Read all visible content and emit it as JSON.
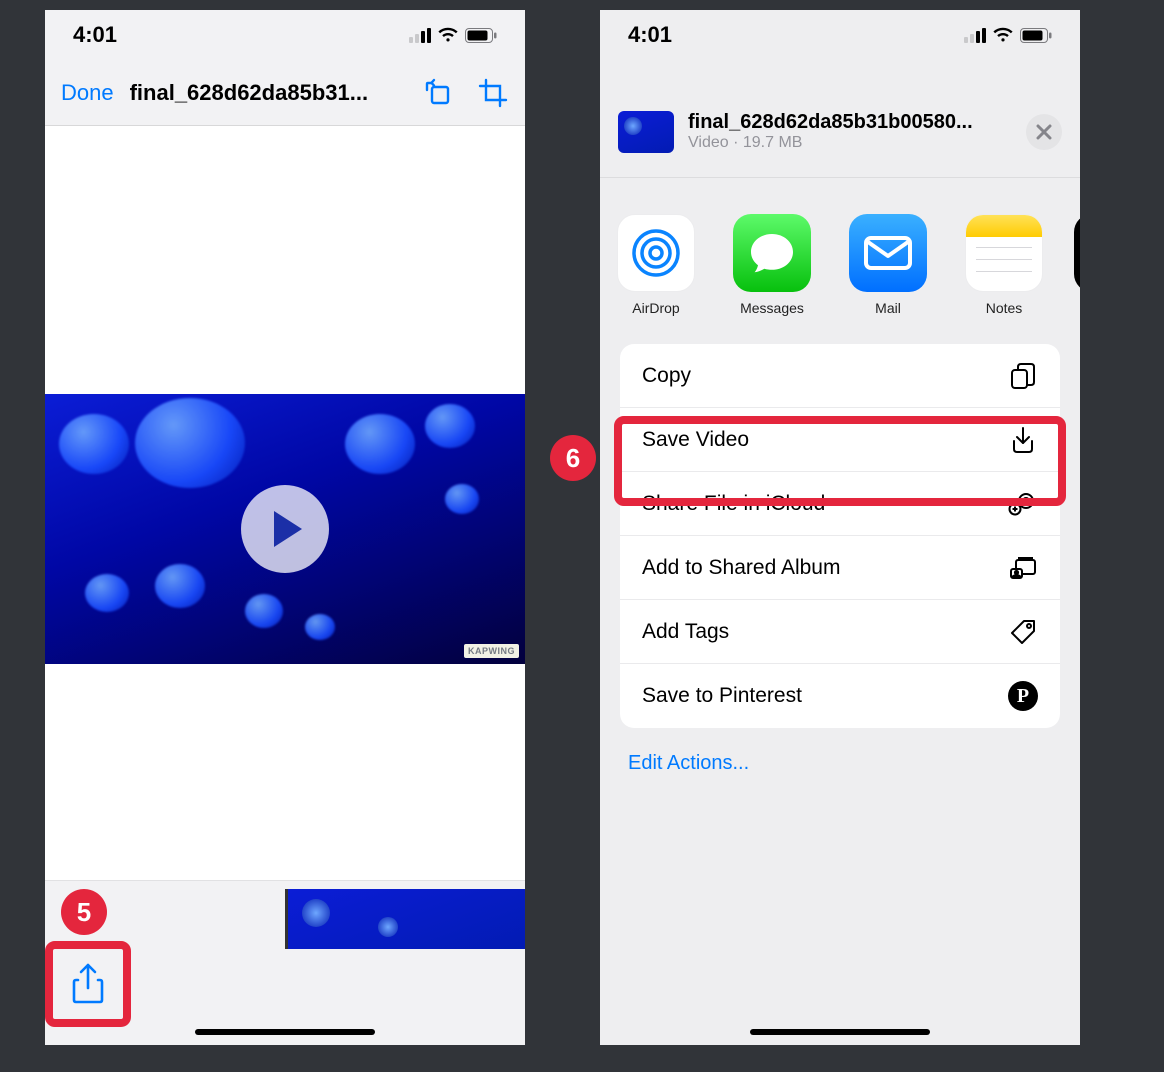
{
  "status": {
    "time": "4:01"
  },
  "phone1": {
    "nav": {
      "done": "Done",
      "filename": "final_628d62da85b31..."
    },
    "watermark": "KAPWING"
  },
  "phone2": {
    "header": {
      "filename": "final_628d62da85b31b00580...",
      "subtitle": "Video · 19.7 MB"
    },
    "apps": {
      "airdrop": "AirDrop",
      "messages": "Messages",
      "mail": "Mail",
      "notes": "Notes"
    },
    "actions": {
      "copy": "Copy",
      "save_video": "Save Video",
      "share_icloud": "Share File in iCloud",
      "add_shared": "Add to Shared Album",
      "add_tags": "Add Tags",
      "pinterest": "Save to Pinterest"
    },
    "edit_actions": "Edit Actions..."
  },
  "badges": {
    "five": "5",
    "six": "6"
  }
}
